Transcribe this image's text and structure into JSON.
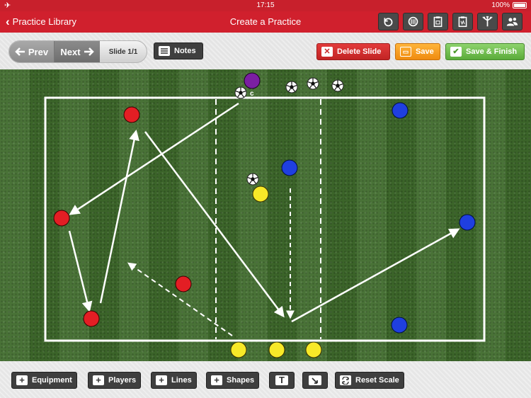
{
  "status": {
    "time": "17:15",
    "battery": "100%"
  },
  "nav": {
    "back_label": "Practice Library",
    "title": "Create a Practice",
    "icons": [
      "undo-icon",
      "mirror-icon",
      "clipboard-icon",
      "copy-icon",
      "tree-icon",
      "users-icon"
    ]
  },
  "toolbar": {
    "prev_label": "Prev",
    "next_label": "Next",
    "slide_indicator": "Slide 1/1",
    "notes_label": "Notes",
    "delete_label": "Delete Slide",
    "save_label": "Save",
    "save_finish_label": "Save & Finish"
  },
  "pitch": {
    "coach_label": "c",
    "colors": {
      "red": "#e31e24",
      "blue": "#1f3fe0",
      "yellow": "#f7e928",
      "purple": "#7b1fa2",
      "grass": "#3f6b2c"
    }
  },
  "bottom": {
    "equipment_label": "Equipment",
    "players_label": "Players",
    "lines_label": "Lines",
    "shapes_label": "Shapes",
    "text_tool": "T",
    "reset_label": "Reset Scale"
  },
  "colors": {
    "brand_red": "#d0202d",
    "save_orange": "#f39a1e",
    "finish_green": "#6cbd4a",
    "dark_button": "#3f3f3f"
  }
}
